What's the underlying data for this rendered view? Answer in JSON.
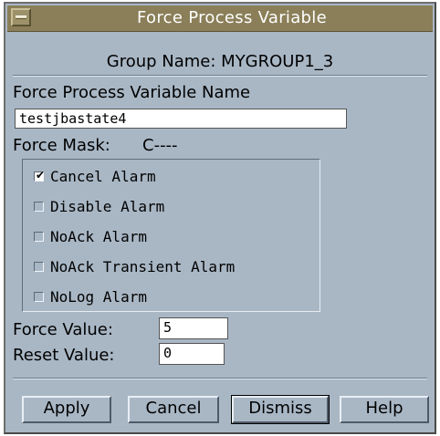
{
  "window": {
    "title": "Force Process Variable"
  },
  "group_name": "Group Name: MYGROUP1_3",
  "pv_name": {
    "label": "Force Process Variable Name",
    "value": "testjbastate4"
  },
  "mask": {
    "label": "Force Mask:",
    "value": "C----"
  },
  "checkboxes": [
    {
      "label": "Cancel Alarm",
      "checked": true
    },
    {
      "label": "Disable Alarm",
      "checked": false
    },
    {
      "label": "NoAck Alarm",
      "checked": false
    },
    {
      "label": "NoAck Transient Alarm",
      "checked": false
    },
    {
      "label": "NoLog Alarm",
      "checked": false
    }
  ],
  "force_value": {
    "label": "Force Value:",
    "value": "5"
  },
  "reset_value": {
    "label": "Reset Value:",
    "value": "0"
  },
  "buttons": {
    "apply": "Apply",
    "cancel": "Cancel",
    "dismiss": "Dismiss",
    "help": "Help"
  },
  "icons": {
    "window_menu": "window-menu-icon",
    "check": "checkmark-icon"
  }
}
